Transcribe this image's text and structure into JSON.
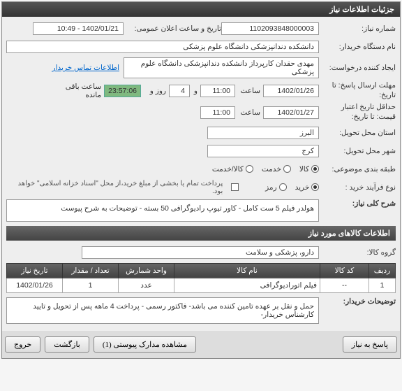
{
  "panel": {
    "title": "جزئیات اطلاعات نیاز"
  },
  "fields": {
    "requestNo": {
      "label": "شماره نیاز:",
      "value": "1102093848000003"
    },
    "announceDate": {
      "label": "تاریخ و ساعت اعلان عمومی:",
      "value": "1402/01/21 - 10:49"
    },
    "buyerDevice": {
      "label": "نام دستگاه خریدار:",
      "value": "دانشکده دندانپزشکی دانشگاه علوم پزشکی"
    },
    "requester": {
      "label": "ایجاد کننده درخواست:",
      "value": "مهدی حقدان کارپرداز دانشکده دندانپزشکی دانشگاه علوم پزشکی",
      "link": "اطلاعات تماس خریدار"
    },
    "deadline": {
      "label": "مهلت ارسال پاسخ: تا تاریخ:",
      "date": "1402/01/26",
      "timeLabel": "ساعت",
      "time": "11:00",
      "daysLabel": "و",
      "days": "4",
      "unitLabel": "روز و",
      "countdown": "23:57:06",
      "suffix": "ساعت باقی مانده"
    },
    "validUntil": {
      "label": "حداقل تاریخ اعتبار قیمت: تا تاریخ:",
      "date": "1402/01/27",
      "timeLabel": "ساعت",
      "time": "11:00"
    },
    "province": {
      "label": "استان محل تحویل:",
      "value": "البرز"
    },
    "city": {
      "label": "شهر محل تحویل:",
      "value": "کرج"
    },
    "category": {
      "label": "طبقه بندی موضوعی:"
    },
    "catOptions": {
      "kala": "کالا",
      "khedmat": "خدمت",
      "kalakhedmat": "کالا/خدمت"
    },
    "process": {
      "label": "نوع فرآیند خرید :"
    },
    "procOptions": {
      "kharid": "خرید",
      "remoz": "رمز"
    },
    "payNote": "پرداخت تمام یا بخشی از مبلغ خرید،از محل \"اسناد خزانه اسلامی\" خواهد بود.",
    "mainDesc": {
      "label": "شرح کلی نیاز:",
      "value": "هولدر فیلم 5 ست کامل - کاور تیوپ رادیوگرافی 50 بسته - توضیحات به شرح پیوست"
    },
    "itemsSection": "اطلاعات کالاهای مورد نیاز",
    "group": {
      "label": "گروه کالا:",
      "value": "دارو، پزشکی و سلامت"
    },
    "table": {
      "headers": {
        "row": "ردیف",
        "code": "کد کالا",
        "name": "نام کالا",
        "unit": "واحد شمارش",
        "qty": "تعداد / مقدار",
        "date": "تاریخ نیاز"
      },
      "rows": [
        {
          "row": "1",
          "code": "--",
          "name": "فیلم اتورادیوگرافی",
          "unit": "عدد",
          "qty": "1",
          "date": "1402/01/26"
        }
      ]
    },
    "buyerNotes": {
      "label": "توضیحات خریدار:",
      "value": "حمل و نقل بر عهده تامین کننده می باشد- فاکتور رسمی - پرداخت 4 ماهه پس از تحویل و تایید کارشناس خریدار-"
    }
  },
  "buttons": {
    "reply": "پاسخ به نیاز",
    "attachments": "مشاهده مدارک پیوستی (1)",
    "back": "بازگشت",
    "exit": "خروج"
  }
}
